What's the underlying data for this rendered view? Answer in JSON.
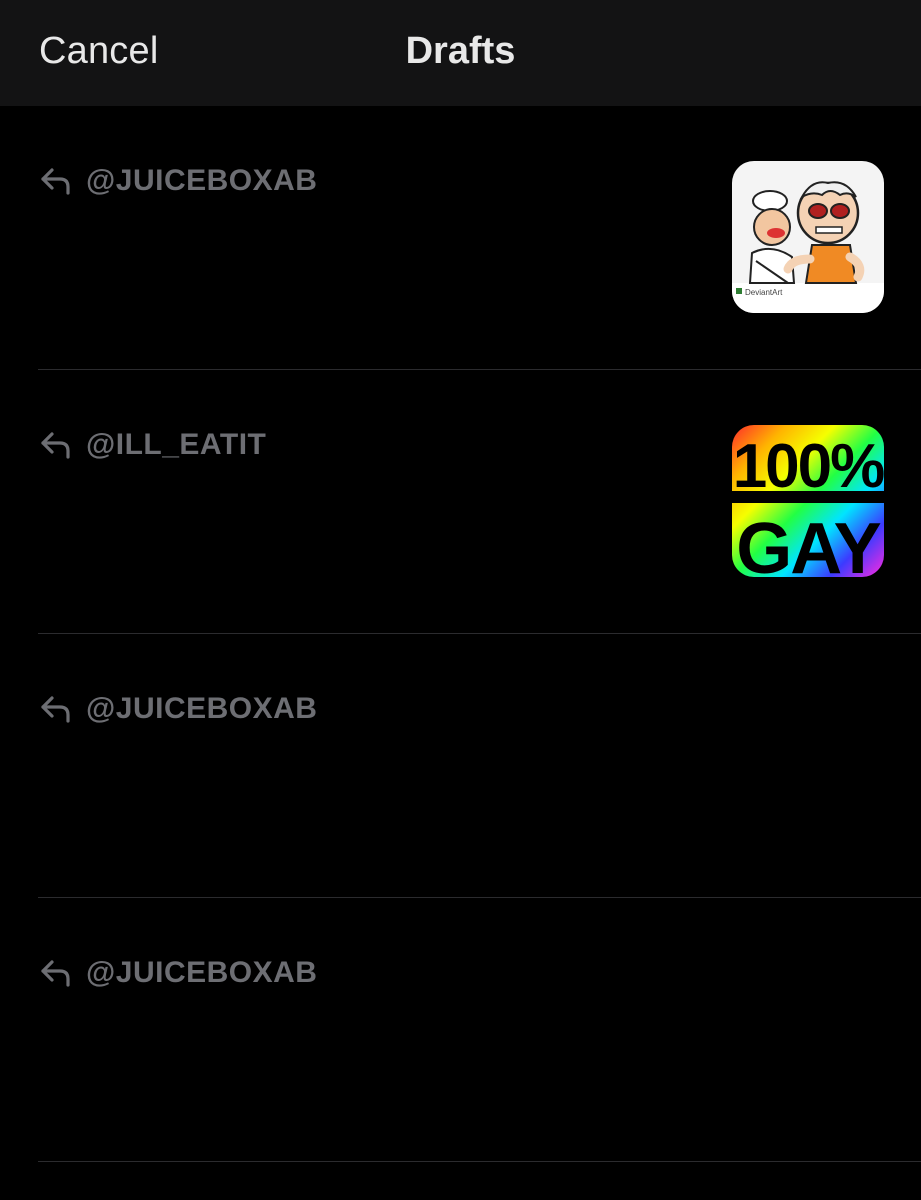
{
  "nav": {
    "cancel_label": "Cancel",
    "title": "Drafts"
  },
  "drafts": [
    {
      "reply_to": "@JUICEBOXAB",
      "thumbnail": "cartoon-image",
      "thumbnail_caption": "DeviantArt"
    },
    {
      "reply_to": "@ILL_EATIT",
      "thumbnail": "rainbow-100-percent-gay-image",
      "thumbnail_text": [
        "100%",
        "GAY"
      ]
    },
    {
      "reply_to": "@JUICEBOXAB"
    },
    {
      "reply_to": "@JUICEBOXAB"
    }
  ],
  "colors": {
    "background": "#000000",
    "nav_background": "#131314",
    "handle_text": "#6d6e73",
    "divider": "#2b2b2e"
  },
  "icons": {
    "reply": "reply-arrow-icon"
  }
}
